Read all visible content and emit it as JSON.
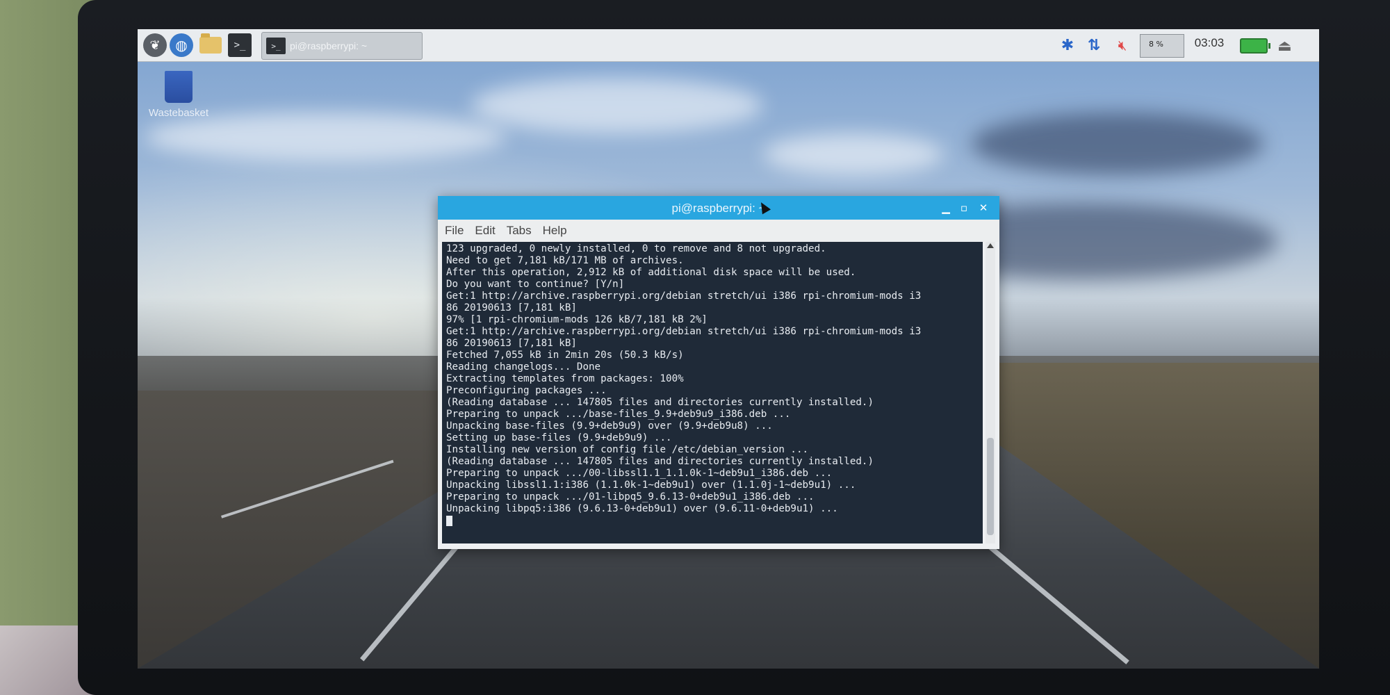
{
  "panel": {
    "taskbar_window_label": "pi@raspberrypi: ~",
    "terminal_glyph": ">_",
    "clock": "03:03",
    "cpu_label": "8 %"
  },
  "desktop": {
    "wastebasket_label": "Wastebasket"
  },
  "terminal": {
    "title": "pi@raspberrypi: ~",
    "menu": [
      "File",
      "Edit",
      "Tabs",
      "Help"
    ],
    "lines": [
      "123 upgraded, 0 newly installed, 0 to remove and 8 not upgraded.",
      "Need to get 7,181 kB/171 MB of archives.",
      "After this operation, 2,912 kB of additional disk space will be used.",
      "Do you want to continue? [Y/n]",
      "Get:1 http://archive.raspberrypi.org/debian stretch/ui i386 rpi-chromium-mods i3",
      "86 20190613 [7,181 kB]",
      "97% [1 rpi-chromium-mods 126 kB/7,181 kB 2%]",
      "Get:1 http://archive.raspberrypi.org/debian stretch/ui i386 rpi-chromium-mods i3",
      "86 20190613 [7,181 kB]",
      "Fetched 7,055 kB in 2min 20s (50.3 kB/s)",
      "Reading changelogs... Done",
      "Extracting templates from packages: 100%",
      "Preconfiguring packages ...",
      "(Reading database ... 147805 files and directories currently installed.)",
      "Preparing to unpack .../base-files_9.9+deb9u9_i386.deb ...",
      "Unpacking base-files (9.9+deb9u9) over (9.9+deb9u8) ...",
      "Setting up base-files (9.9+deb9u9) ...",
      "Installing new version of config file /etc/debian_version ...",
      "(Reading database ... 147805 files and directories currently installed.)",
      "Preparing to unpack .../00-libssl1.1_1.1.0k-1~deb9u1_i386.deb ...",
      "Unpacking libssl1.1:i386 (1.1.0k-1~deb9u1) over (1.1.0j-1~deb9u1) ...",
      "Preparing to unpack .../01-libpq5_9.6.13-0+deb9u1_i386.deb ...",
      "Unpacking libpq5:i386 (9.6.13-0+deb9u1) over (9.6.11-0+deb9u1) ..."
    ]
  }
}
